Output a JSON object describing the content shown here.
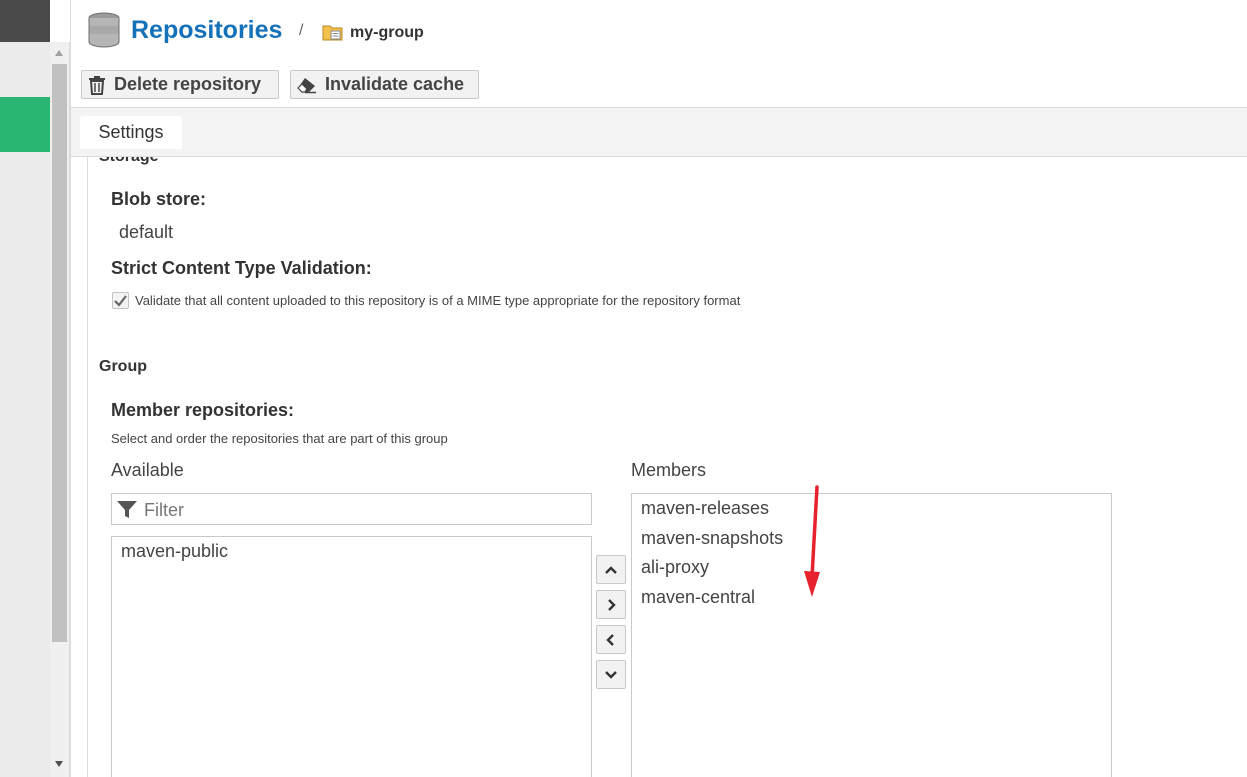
{
  "header": {
    "title": "Repositories",
    "separator": "/",
    "breadcrumb_item": "my-group"
  },
  "toolbar": {
    "delete_label": "Delete repository",
    "invalidate_label": "Invalidate cache"
  },
  "tabs": [
    {
      "label": "Settings",
      "active": true
    }
  ],
  "storage": {
    "legend": "Storage",
    "blob_store_label": "Blob store:",
    "blob_store_value": "default",
    "strict_label": "Strict Content Type Validation:",
    "strict_checked": true,
    "strict_description": "Validate that all content uploaded to this repository is of a MIME type appropriate for the repository format"
  },
  "group": {
    "legend": "Group",
    "member_label": "Member repositories:",
    "member_help": "Select and order the repositories that are part of this group",
    "available_header": "Available",
    "members_header": "Members",
    "filter_placeholder": "Filter",
    "available_items": [
      "maven-public"
    ],
    "member_items": [
      "maven-releases",
      "maven-snapshots",
      "ali-proxy",
      "maven-central"
    ]
  },
  "icons": {
    "database": "database-icon",
    "folder": "folder-icon",
    "trash": "trash-icon",
    "eraser": "eraser-icon",
    "filter": "filter-icon"
  },
  "colors": {
    "title": "#1571b8",
    "sidebar_active": "#29b572",
    "annotation_arrow": "#e8212e"
  }
}
